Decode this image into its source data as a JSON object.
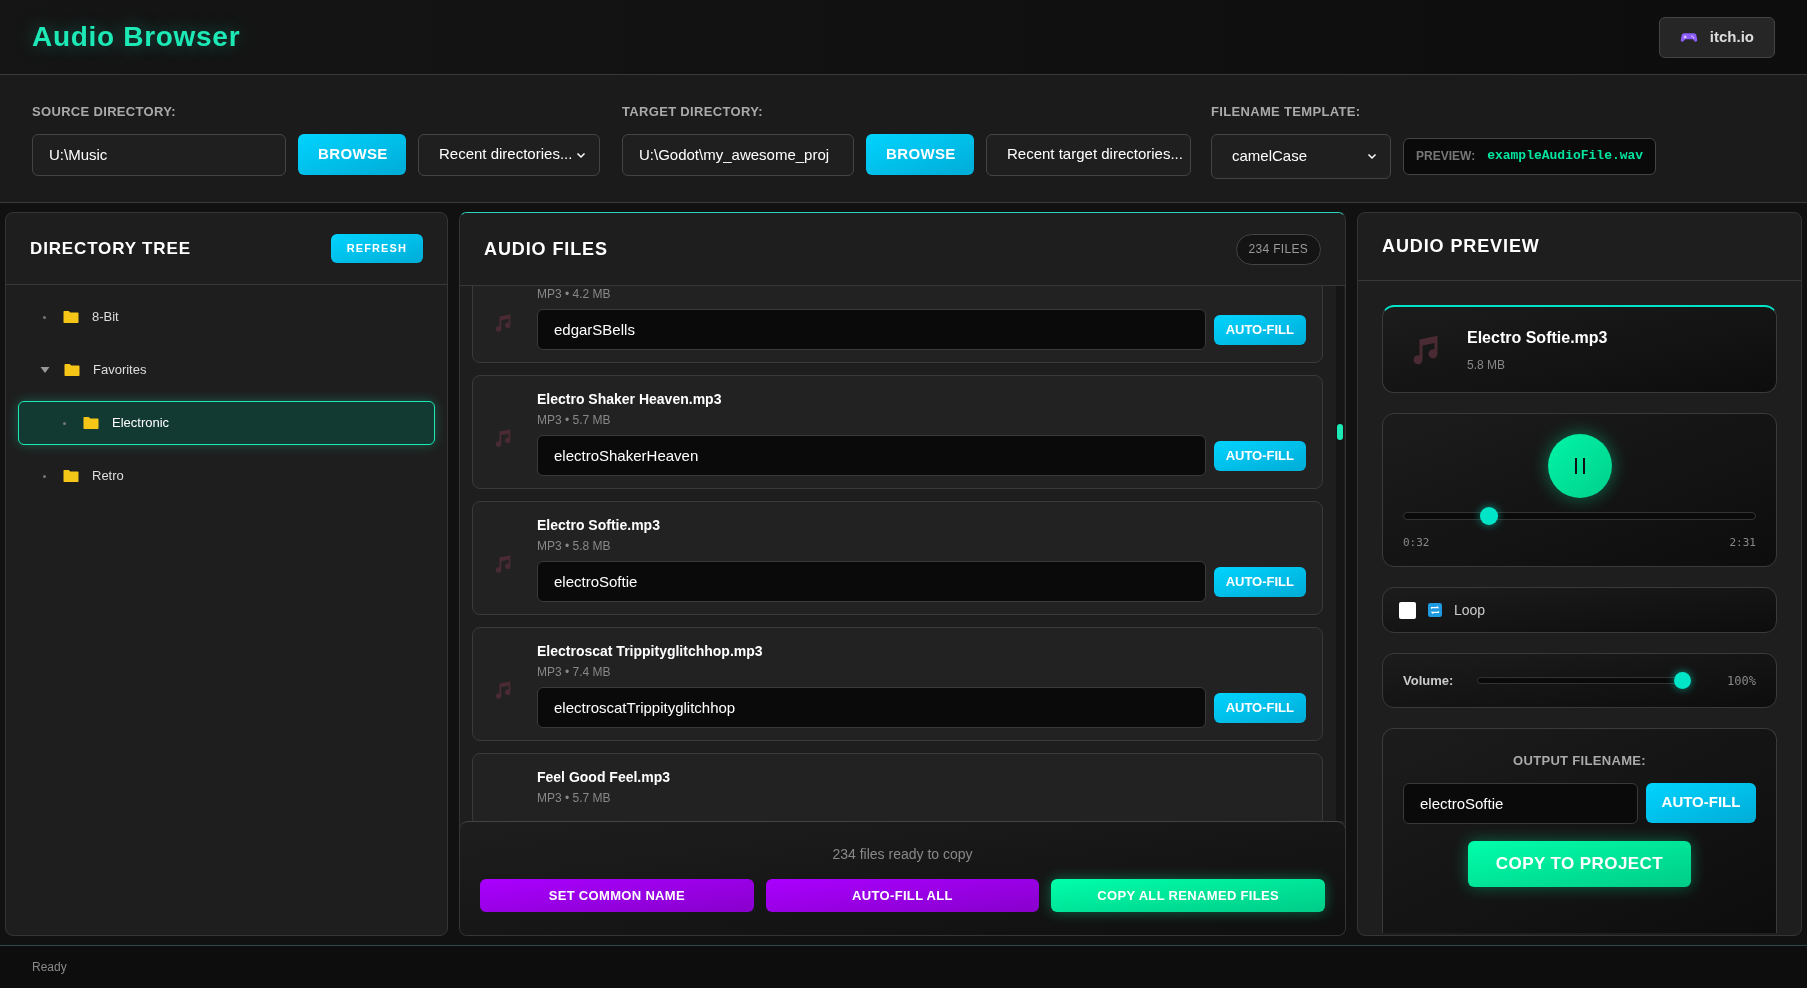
{
  "app": {
    "title": "Audio Browser",
    "link": "itch.io"
  },
  "toolbar": {
    "source": {
      "label": "SOURCE DIRECTORY:",
      "value": "U:\\Music",
      "browse": "BROWSE",
      "recent": "Recent directories..."
    },
    "target": {
      "label": "TARGET DIRECTORY:",
      "value": "U:\\Godot\\my_awesome_proj",
      "browse": "BROWSE",
      "recent": "Recent target directories..."
    },
    "template": {
      "label": "FILENAME TEMPLATE:",
      "value": "camelCase",
      "preview_label": "PREVIEW:",
      "preview": "exampleAudioFile.wav"
    }
  },
  "tree": {
    "title": "DIRECTORY TREE",
    "refresh": "REFRESH",
    "items": [
      {
        "label": "8-Bit",
        "selected": false
      },
      {
        "label": "Favorites",
        "expanded": true,
        "selected": false,
        "children": [
          {
            "label": "Electronic",
            "selected": true
          }
        ]
      },
      {
        "label": "Retro",
        "selected": false
      }
    ]
  },
  "files": {
    "title": "AUDIO FILES",
    "count": "234 FILES",
    "items": [
      {
        "meta": "MP3 • 4.2 MB",
        "value": "edgarSBells",
        "button": "AUTO-FILL"
      },
      {
        "name": "Electro Shaker Heaven.mp3",
        "meta": "MP3 • 5.7 MB",
        "value": "electroShakerHeaven",
        "button": "AUTO-FILL"
      },
      {
        "name": "Electro Softie.mp3",
        "meta": "MP3 • 5.8 MB",
        "value": "electroSoftie",
        "button": "AUTO-FILL"
      },
      {
        "name": "Electroscat Trippityglitchhop.mp3",
        "meta": "MP3 • 7.4 MB",
        "value": "electroscatTrippityglitchhop",
        "button": "AUTO-FILL"
      },
      {
        "name": "Feel Good Feel.mp3",
        "meta": "MP3 • 5.7 MB"
      }
    ],
    "summary": "234 files ready to copy",
    "actions": [
      "SET COMMON NAME",
      "AUTO-FILL ALL",
      "COPY ALL RENAMED FILES"
    ]
  },
  "preview": {
    "title": "AUDIO PREVIEW",
    "name": "Electro Softie.mp3",
    "size": "5.8 MB",
    "playing": true,
    "progress": {
      "level": 0.23,
      "current": "0:32",
      "total": "2:31"
    },
    "loop": {
      "label": "Loop",
      "checked": false
    },
    "volume": {
      "label": "Volume:",
      "level": 1,
      "reading": "100%"
    },
    "output": {
      "label": "OUTPUT FILENAME:",
      "value": "electroSoftie",
      "autofill": "AUTO-FILL",
      "copy": "COPY TO PROJECT"
    }
  },
  "status_bar": "Ready"
}
